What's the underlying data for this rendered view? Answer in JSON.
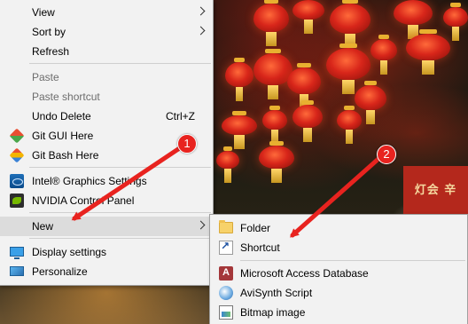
{
  "context_menu": {
    "items": [
      {
        "label": "View",
        "submenu": true
      },
      {
        "label": "Sort by",
        "submenu": true
      },
      {
        "label": "Refresh"
      },
      {
        "label": "Paste",
        "disabled": true
      },
      {
        "label": "Paste shortcut",
        "disabled": true
      },
      {
        "label": "Undo Delete",
        "shortcut": "Ctrl+Z"
      },
      {
        "label": "Git GUI Here",
        "icon": "git-gui-icon"
      },
      {
        "label": "Git Bash Here",
        "icon": "git-bash-icon"
      },
      {
        "label": "Intel® Graphics Settings",
        "icon": "intel-graphics-icon"
      },
      {
        "label": "NVIDIA Control Panel",
        "icon": "nvidia-icon"
      },
      {
        "label": "New",
        "submenu": true,
        "highlighted": true
      },
      {
        "label": "Display settings",
        "icon": "display-settings-icon"
      },
      {
        "label": "Personalize",
        "icon": "personalize-icon"
      }
    ]
  },
  "new_submenu": {
    "items": [
      {
        "label": "Folder",
        "icon": "folder-icon"
      },
      {
        "label": "Shortcut",
        "icon": "shortcut-icon"
      },
      {
        "label": "Microsoft Access Database",
        "icon": "access-database-icon"
      },
      {
        "label": "AviSynth Script",
        "icon": "avisynth-icon"
      },
      {
        "label": "Bitmap image",
        "icon": "bitmap-icon"
      }
    ]
  },
  "annotations": {
    "step1": "1",
    "step2": "2",
    "arrow_color": "#e8231f"
  },
  "wallpaper": {
    "sign_text": "灯会 辛"
  }
}
